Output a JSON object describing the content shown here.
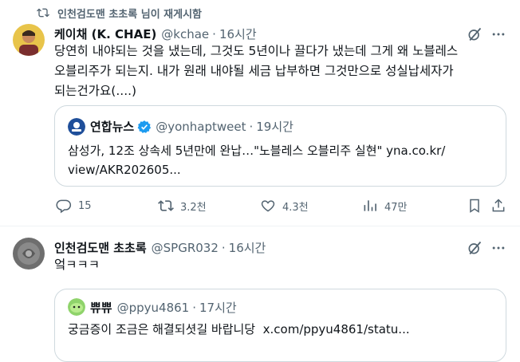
{
  "retweet_banner": {
    "text": "인천검도맨 초초록 님이 재게시함"
  },
  "tweet1": {
    "display_name": "케이채 (K. CHAE)",
    "handle": "@kchae",
    "separator": "·",
    "time": "16시간",
    "text_line1": "당연히 내야되는 것을 냈는데, 그것도 5년이나 끌다가 냈는데 그게 왜 노블레스",
    "text_line2": "오블리주가 되는지. 내가 원래 내야될 세금 납부하면 그것만으로 성실납세자가",
    "text_line3": "되는건가요(....)",
    "quote": {
      "display_name": "연합뉴스",
      "handle": "@yonhaptweet",
      "separator": "·",
      "time": "19시간",
      "text_line1": "삼성가, 12조 상속세 5년만에 완납…\"노블레스 오블리주 실현\" yna.co.kr/",
      "text_line2": "view/AKR202605..."
    },
    "metrics": {
      "replies": "15",
      "reposts": "3.2천",
      "likes": "4.3천",
      "views": "47만"
    }
  },
  "tweet2": {
    "display_name": "인천검도맨 초초록",
    "handle": "@SPGR032",
    "separator": "·",
    "time": "16시간",
    "text": "엌ㅋㅋㅋ",
    "quote": {
      "display_name": "쀼쀼",
      "handle": "@ppyu4861",
      "separator": "·",
      "time": "17시간",
      "text": "궁금증이 조금은 해결되셧길 바랍니당  x.com/ppyu4861/statu..."
    }
  },
  "icons": [
    "repost-icon",
    "grok-icon",
    "more-icon",
    "reply-icon",
    "like-icon",
    "views-icon",
    "share-icon",
    "verified-badge-icon"
  ],
  "colors": {
    "text": "#0f1419",
    "muted": "#536471",
    "border": "#cfd9de",
    "verified": "#1d9bf0",
    "reposted": "#00ba7c"
  }
}
